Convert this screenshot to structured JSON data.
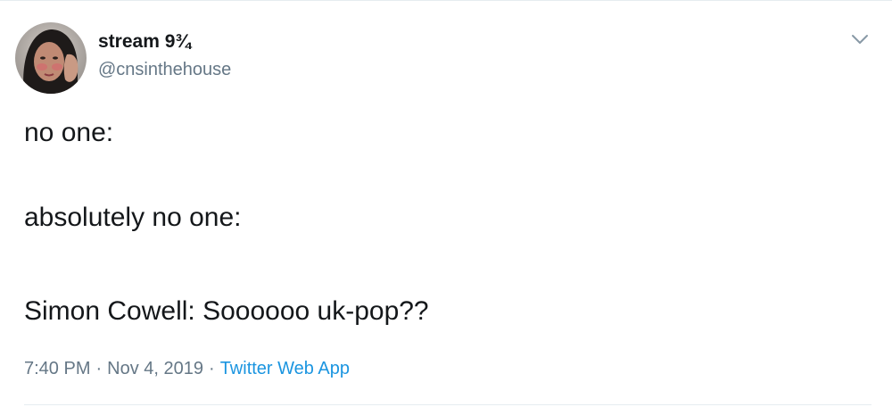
{
  "user": {
    "display_name": "stream 9¾",
    "handle": "@cnsinthehouse",
    "avatar_icon": "profile-photo"
  },
  "tweet": {
    "lines": [
      "no one:",
      "absolutely no one:",
      "Simon Cowell: Soooooo uk-pop??"
    ],
    "time": "7:40 PM",
    "date": "Nov 4, 2019",
    "separator": "·",
    "source": "Twitter Web App"
  },
  "menu": {
    "icon": "chevron-down-icon"
  },
  "colors": {
    "text": "#14171a",
    "secondary": "#657786",
    "link": "#1b95e0",
    "border": "#e6ecf0"
  }
}
